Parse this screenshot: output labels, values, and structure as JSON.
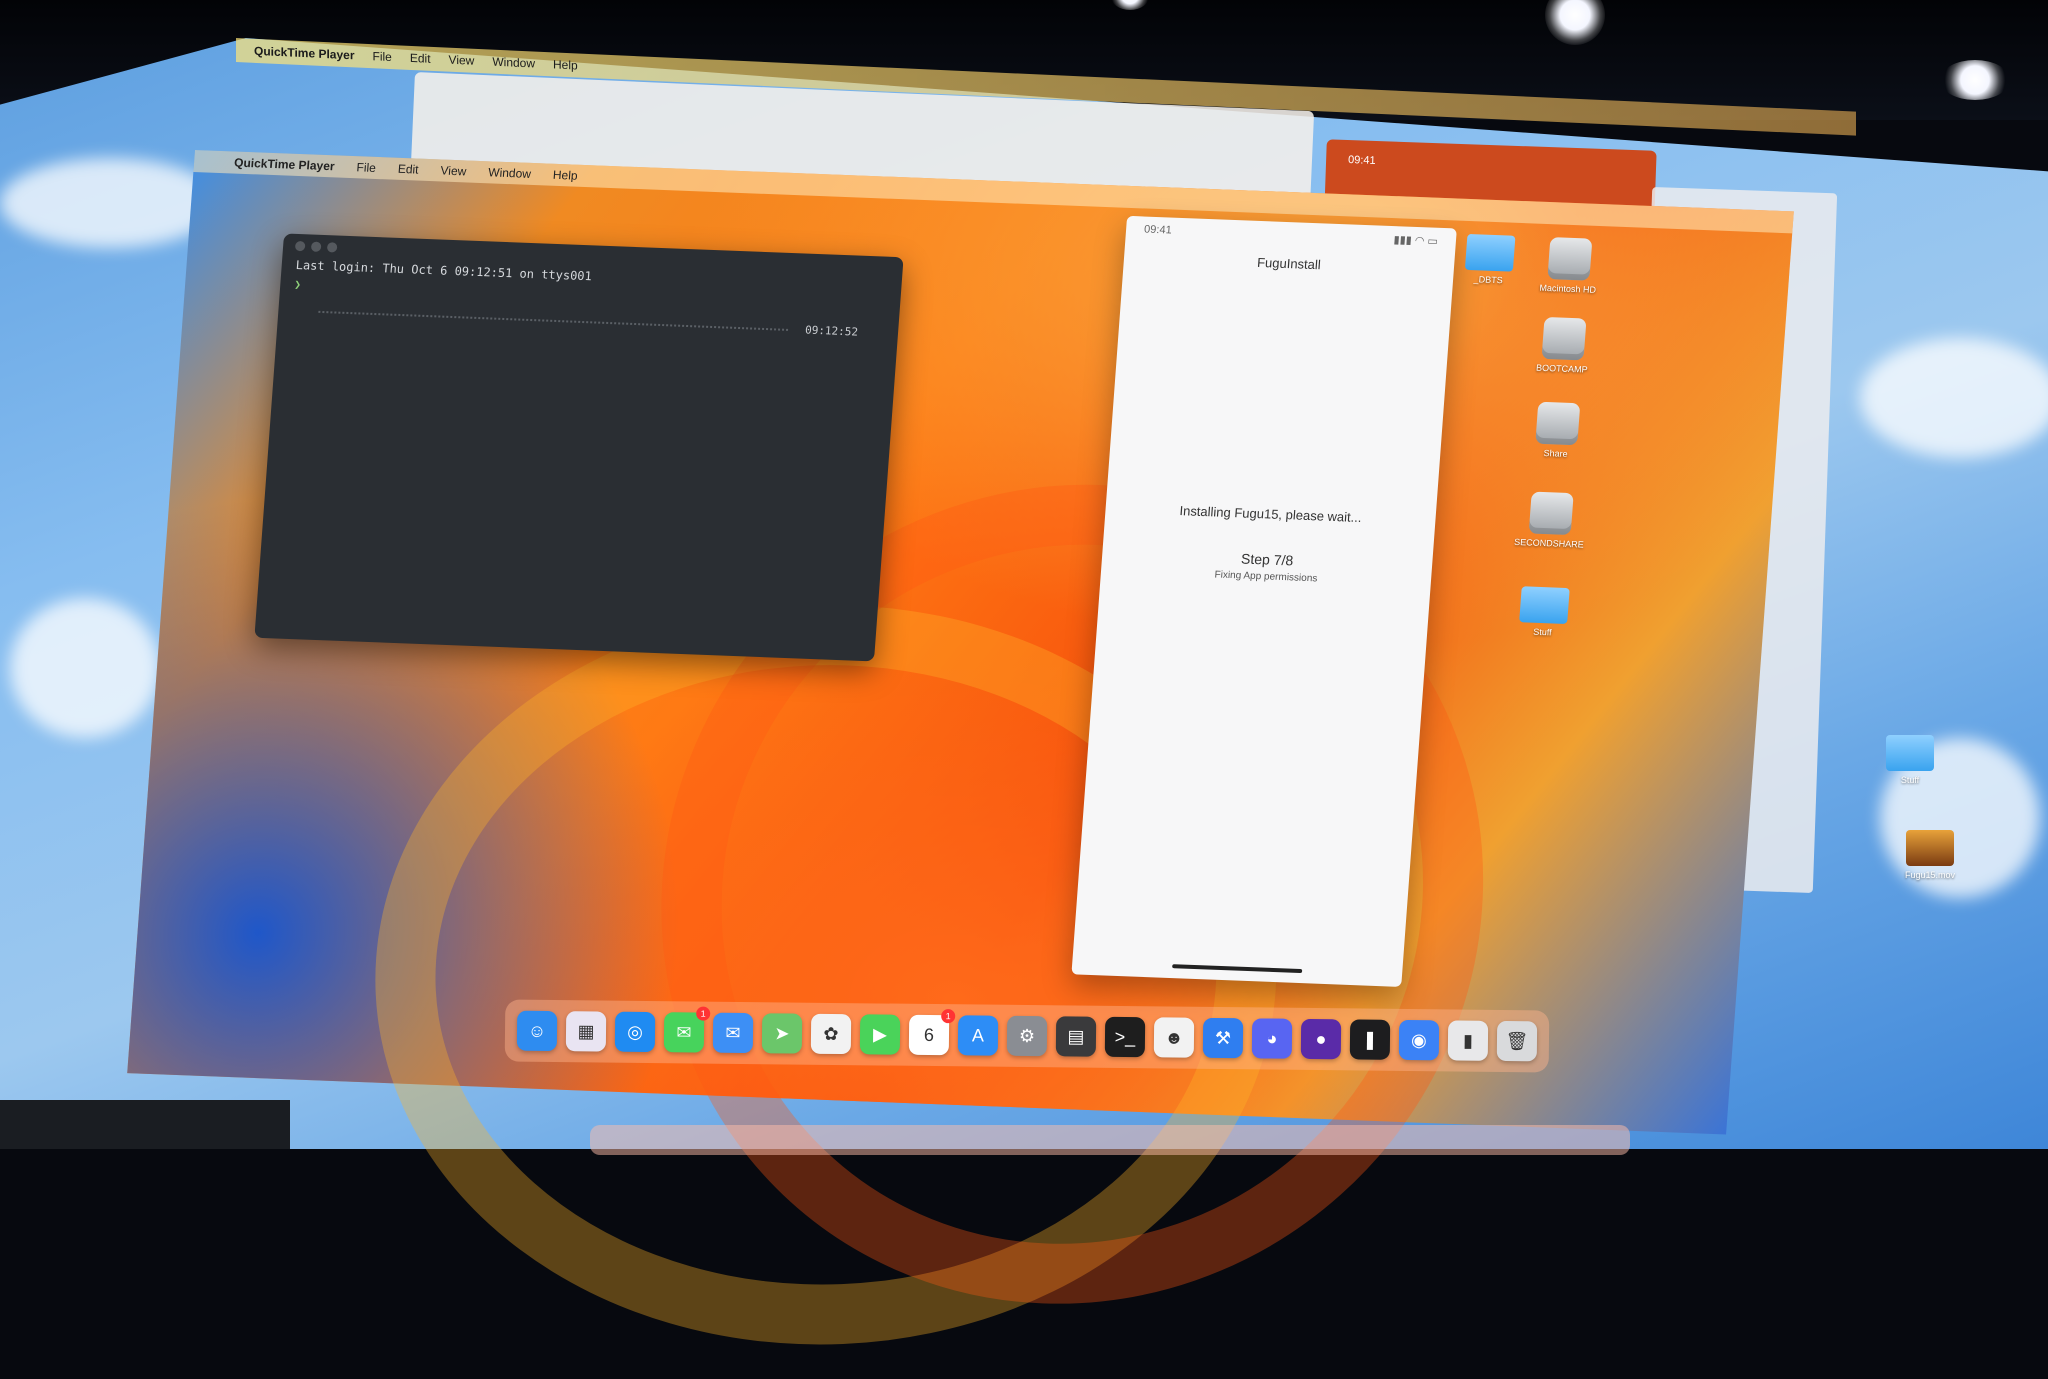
{
  "outer_menubar": {
    "app_name": "QuickTime Player",
    "items": [
      "File",
      "Edit",
      "View",
      "Window",
      "Help"
    ]
  },
  "inner_menubar": {
    "app_name": "QuickTime Player",
    "items": [
      "File",
      "Edit",
      "View",
      "Window",
      "Help"
    ]
  },
  "background_phone": {
    "time": "09:41"
  },
  "terminal": {
    "last_login": "Last login: Thu Oct  6 09:12:51 on ttys001",
    "prompt": "❯",
    "timestamp": "09:12:52"
  },
  "phone_app": {
    "status_time": "09:41",
    "title": "FuguInstall",
    "message": "Installing Fugu15, please wait...",
    "step": "Step 7/8",
    "substep": "Fixing App permissions"
  },
  "desktop_icons": [
    {
      "label": "_DBTS",
      "type": "folder"
    },
    {
      "label": "Macintosh HD",
      "type": "disk"
    },
    {
      "label": "BOOTCAMP",
      "type": "disk"
    },
    {
      "label": "Share",
      "type": "disk"
    },
    {
      "label": "SECONDSHARE",
      "type": "disk"
    },
    {
      "label": "Stuff",
      "type": "folder"
    }
  ],
  "outer_desktop_icons": [
    {
      "label": "Stuff",
      "type": "folder"
    },
    {
      "label": "Fugu15.mov",
      "type": "video"
    }
  ],
  "dock": {
    "apps": [
      {
        "name": "finder-icon",
        "color": "#2e8cf0",
        "glyph": "☺"
      },
      {
        "name": "launchpad-icon",
        "color": "#e9e4f2",
        "glyph": "▦"
      },
      {
        "name": "safari-icon",
        "color": "#1f8bf2",
        "glyph": "◎"
      },
      {
        "name": "messages-icon",
        "color": "#47d35c",
        "glyph": "✉",
        "badge": "1"
      },
      {
        "name": "mail-icon",
        "color": "#3d8ff5",
        "glyph": "✉"
      },
      {
        "name": "maps-icon",
        "color": "#6bc66a",
        "glyph": "➤"
      },
      {
        "name": "photos-icon",
        "color": "#f2f2f2",
        "glyph": "✿"
      },
      {
        "name": "facetime-icon",
        "color": "#4ad35a",
        "glyph": "▶"
      },
      {
        "name": "calendar-icon",
        "color": "#ffffff",
        "glyph": "6",
        "badge": "1"
      },
      {
        "name": "app-store-icon",
        "color": "#2d8df6",
        "glyph": "A"
      },
      {
        "name": "system-settings-icon",
        "color": "#8a8d93",
        "glyph": "⚙"
      },
      {
        "name": "calculator-icon",
        "color": "#3a3a3c",
        "glyph": "▤"
      },
      {
        "name": "terminal-icon",
        "color": "#1e1e1e",
        "glyph": ">_"
      },
      {
        "name": "memoji-icon",
        "color": "#f2f2f2",
        "glyph": "☻"
      },
      {
        "name": "xcode-icon",
        "color": "#2f7ef0",
        "glyph": "⚒"
      },
      {
        "name": "discord-icon",
        "color": "#5865f2",
        "glyph": "◕"
      },
      {
        "name": "github-icon",
        "color": "#5a2ba8",
        "glyph": "●"
      },
      {
        "name": "git-client-icon",
        "color": "#1d1d1f",
        "glyph": "❚"
      },
      {
        "name": "proxyman-icon",
        "color": "#3b82f6",
        "glyph": "◉"
      },
      {
        "name": "downloads-icon",
        "color": "#e8e8ea",
        "glyph": "▮"
      },
      {
        "name": "trash-icon",
        "color": "#d9dadc",
        "glyph": "🗑"
      }
    ]
  },
  "colors": {
    "terminal_bg": "#2a2e33",
    "phone_bg": "#f7f7f8",
    "accent_orange": "#ff7a14"
  }
}
